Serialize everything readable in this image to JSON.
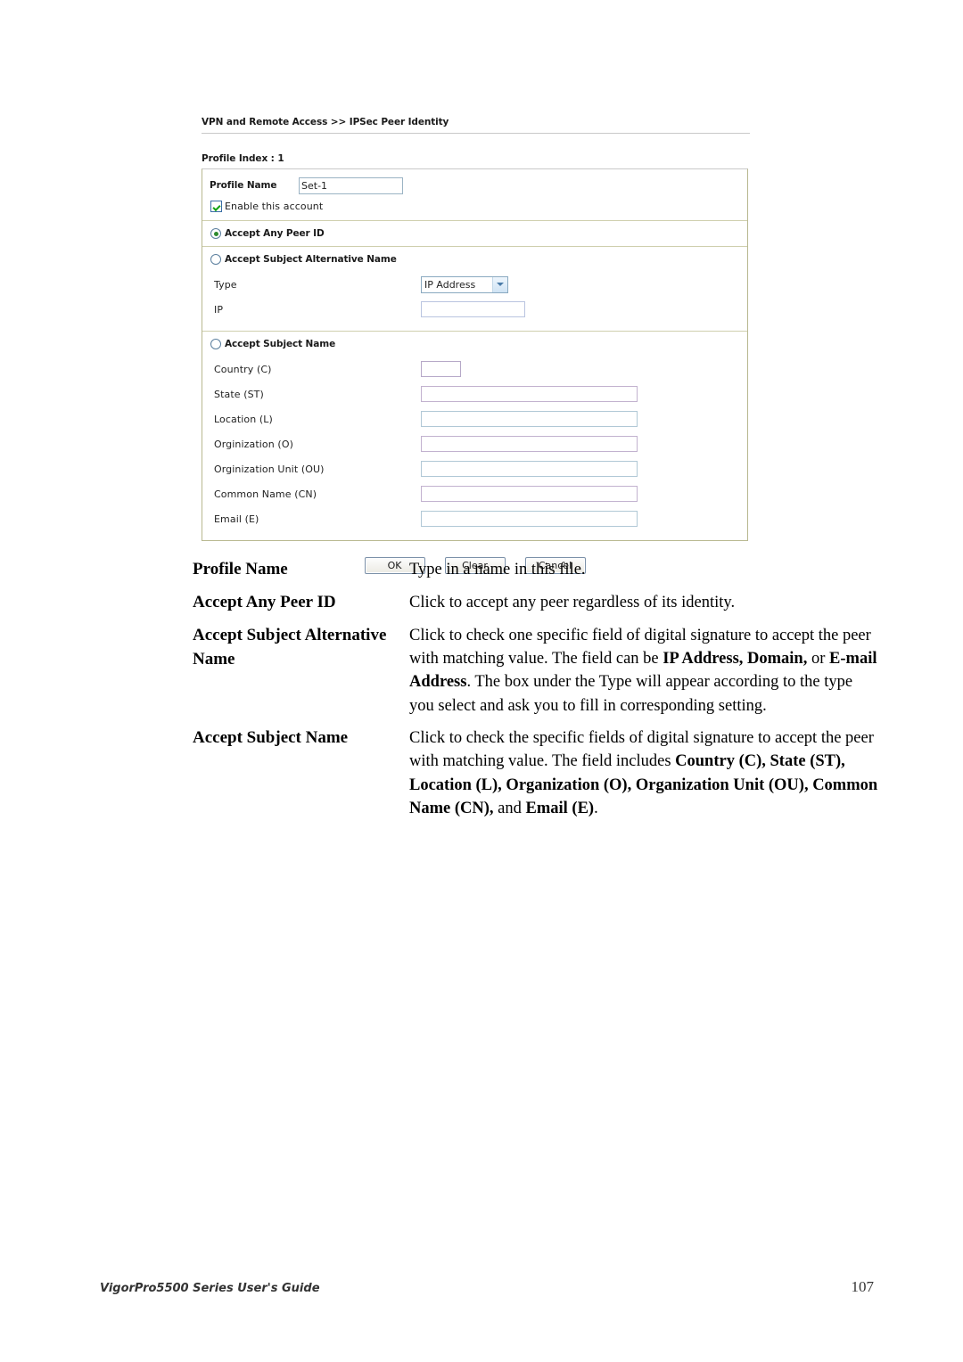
{
  "page": {
    "footer_left": "VigorPro5500 Series User's Guide",
    "footer_right": "107"
  },
  "screenshot": {
    "breadcrumb": "VPN and Remote Access >> IPSec Peer Identity",
    "profile_index": "Profile Index : 1",
    "profile_name_label": "Profile Name",
    "profile_name_value": "Set-1",
    "enable_account_label": "Enable this account",
    "enable_account_checked": true,
    "accept_any_peer_id_label": "Accept Any Peer ID",
    "accept_any_peer_id_selected": true,
    "accept_subject_alt_name_label": "Accept Subject Alternative Name",
    "accept_subject_alt_name_selected": false,
    "alt_fields": [
      {
        "label": "Type",
        "kind": "select",
        "value": "IP Address"
      },
      {
        "label": "IP",
        "kind": "text",
        "value": ""
      }
    ],
    "accept_subject_name_label": "Accept Subject Name",
    "accept_subject_name_selected": false,
    "subject_fields": [
      {
        "label": "Country (C)",
        "value": ""
      },
      {
        "label": "State (ST)",
        "value": ""
      },
      {
        "label": "Location (L)",
        "value": ""
      },
      {
        "label": "Orginization (O)",
        "value": ""
      },
      {
        "label": "Orginization Unit (OU)",
        "value": ""
      },
      {
        "label": "Common Name (CN)",
        "value": ""
      },
      {
        "label": "Email (E)",
        "value": ""
      }
    ],
    "buttons": {
      "ok": "OK",
      "clear": "Clear",
      "cancel": "Cancel"
    }
  },
  "explanations": [
    {
      "term": "Profile Name",
      "desc_plain": "Type in a name in this file."
    },
    {
      "term": "Accept Any Peer ID",
      "desc_plain": "Click to accept any peer regardless of its identity."
    },
    {
      "term": "Accept Subject Alternative Name",
      "desc_plain": "Click to check one specific field of digital signature to accept the peer with matching value. The field can be IP Address, Domain, or E-mail Address. The box under the Type will appear according to the type you select and ask you to fill in corresponding setting."
    },
    {
      "term": "Accept Subject Name",
      "desc_plain": "Click to check the specific fields of digital signature to accept the peer with matching value. The field includes Country (C), State (ST), Location (L), Organization (O), Organization Unit (OU), Common Name (CN), and Email (E)."
    }
  ]
}
